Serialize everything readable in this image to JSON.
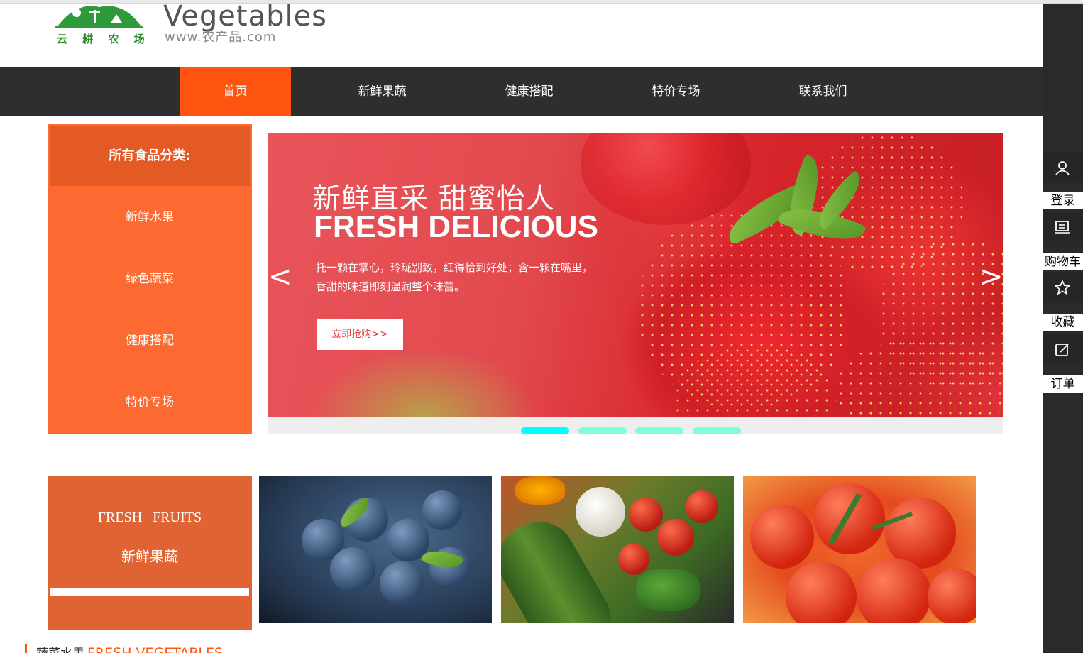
{
  "header": {
    "logo_text": "云 耕 农 场",
    "brand": "Vegetables",
    "url": "www.农产品.com"
  },
  "nav": {
    "items": [
      {
        "label": "首页",
        "active": true
      },
      {
        "label": "新鲜果蔬"
      },
      {
        "label": "健康搭配"
      },
      {
        "label": "特价专场"
      },
      {
        "label": "联系我们"
      }
    ]
  },
  "categories": {
    "title": "所有食品分类:",
    "items": [
      "新鲜水果",
      "绿色蔬菜",
      "健康搭配",
      "特价专场"
    ]
  },
  "banner": {
    "title_cn": "新鲜直采 甜蜜怡人",
    "title_en": "FRESH DELICIOUS",
    "desc_line1": "托一颗在掌心，玲珑别致，红得恰到好处；含一颗在嘴里，",
    "desc_line2": "香甜的味道即刻温润整个味蕾。",
    "button": "立即抢购>>",
    "prev": "<",
    "next": ">",
    "slide_count": 4,
    "active_slide": 1
  },
  "fresh": {
    "title_en": "FRESH FRUITS",
    "title_cn": "新鲜果蔬"
  },
  "section": {
    "title_cn": "蔬菜水果",
    "title_en": "FRESH VEGETABLES"
  },
  "sidebar": {
    "items": [
      "登录",
      "购物车",
      "收藏",
      "订单"
    ],
    "icons": [
      "user-icon",
      "cart-icon",
      "star-icon",
      "edit-icon"
    ]
  },
  "colors": {
    "accent": "#ff5410",
    "nav_bg": "#2e2e2e",
    "category_bg": "#fd6a31",
    "pager_active": "#00ffff",
    "pager_inactive": "#7fffd4"
  }
}
